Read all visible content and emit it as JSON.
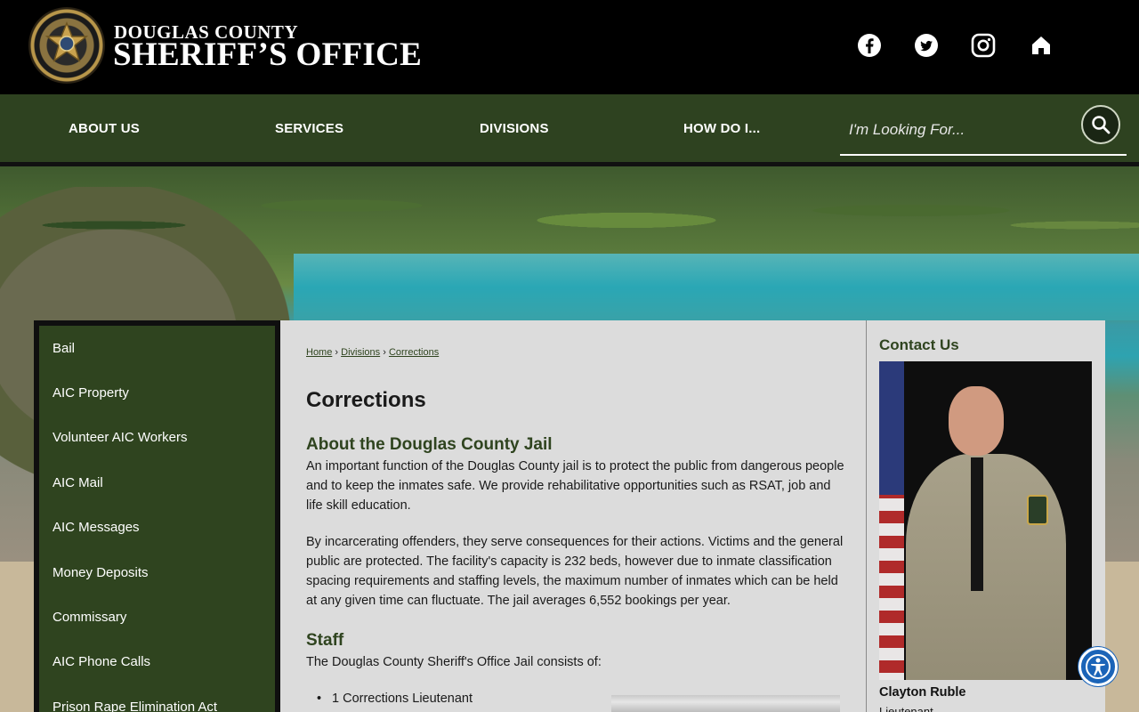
{
  "header": {
    "brand_line1": "DOUGLAS COUNTY",
    "brand_line2": "SHERIFF’S OFFICE",
    "logo_icon": "sheriff-badge-icon",
    "social": [
      "facebook-icon",
      "twitter-icon",
      "instagram-icon",
      "home-icon"
    ]
  },
  "nav": {
    "items": [
      {
        "label": "ABOUT US"
      },
      {
        "label": "SERVICES"
      },
      {
        "label": "DIVISIONS"
      },
      {
        "label": "HOW DO I..."
      }
    ],
    "search_placeholder": "I'm Looking For...",
    "search_icon": "search-icon"
  },
  "sidebar": {
    "items": [
      {
        "label": "Bail"
      },
      {
        "label": "AIC Property"
      },
      {
        "label": "Volunteer AIC Workers"
      },
      {
        "label": "AIC Mail"
      },
      {
        "label": "AIC Messages"
      },
      {
        "label": "Money Deposits"
      },
      {
        "label": "Commissary"
      },
      {
        "label": "AIC Phone Calls"
      },
      {
        "label": "Prison Rape Elimination Act"
      }
    ]
  },
  "breadcrumb": {
    "items": [
      "Home",
      "Divisions",
      "Corrections"
    ],
    "separator": "›"
  },
  "main": {
    "title": "Corrections",
    "section1_heading": "About the Douglas County Jail",
    "para1": "An important function of the Douglas County jail is to protect the public from dangerous people and to keep the inmates safe. We provide rehabilitative opportunities such as RSAT, job and life skill education.",
    "para2": "By incarcerating offenders, they serve consequences for their actions. Victims and the general public are protected. The facility's capacity is 232 beds, however due to inmate classification spacing requirements and staffing levels, the maximum number of inmates which can be held at any given time can fluctuate. The jail averages 6,552 bookings per year.",
    "section2_heading": "Staff",
    "para3": "The Douglas County Sheriff's Office Jail consists of:",
    "bullets": [
      "1 Corrections Lieutenant"
    ]
  },
  "contact": {
    "title": "Contact Us",
    "name": "Clayton Ruble",
    "role": "Lieutenant"
  },
  "colors": {
    "nav_green": "#2e4220",
    "sidebar_green": "#2f441f",
    "accent_blue": "#1b64b8"
  }
}
